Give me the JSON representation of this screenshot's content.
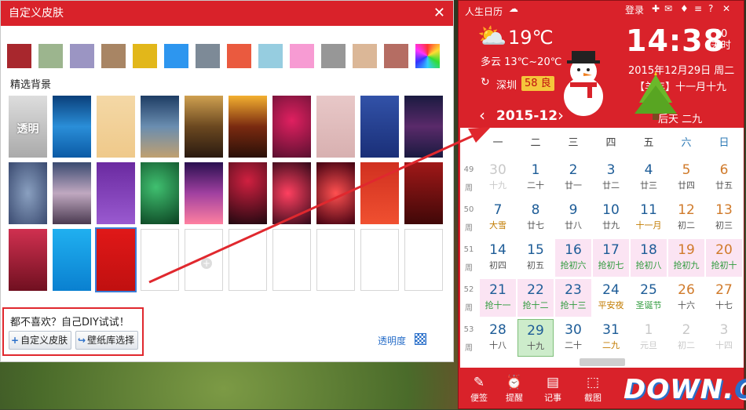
{
  "dialog": {
    "title": "自定义皮肤",
    "close": "✕",
    "swatches": [
      "#a8272d",
      "#9cb58e",
      "#9b95c3",
      "#a88564",
      "#e2b71a",
      "#2d96ef",
      "#7d8a97",
      "#ea5a3f",
      "#96cde0",
      "#f79bd3",
      "#979797",
      "#dbb797",
      "#b56d63",
      "rainbow"
    ],
    "section_title": "精选背景",
    "transparent_label": "透明",
    "diy_text": "都不喜欢？自己DIY试试！",
    "custom_btn": "自定义皮肤",
    "wallpaper_btn": "壁纸库选择",
    "opacity_label": "透明度"
  },
  "calendar": {
    "app_name": "人生日历",
    "login": "登录",
    "temperature": "19℃",
    "weather": "多云 13℃~20℃",
    "city": "深圳",
    "aqi": "58 良",
    "time": "14:38",
    "seconds": "10",
    "seconds_label": "未时",
    "date": "2015年12月29日 周二",
    "lunar": "【羊年】十一月十九",
    "month": "2015-12",
    "holiday_hint": "后天 二九",
    "weekdays": [
      "一",
      "二",
      "三",
      "四",
      "五",
      "六",
      "日"
    ],
    "week_numbers": [
      [
        "49",
        "周"
      ],
      [
        "50",
        "周"
      ],
      [
        "51",
        "周"
      ],
      [
        "52",
        "周"
      ],
      [
        "53",
        "周"
      ]
    ],
    "days": [
      [
        [
          "30",
          "十九",
          "out"
        ],
        [
          "1",
          "二十",
          ""
        ],
        [
          "2",
          "廿一",
          ""
        ],
        [
          "3",
          "廿二",
          ""
        ],
        [
          "4",
          "廿三",
          ""
        ],
        [
          "5",
          "廿四",
          "we"
        ],
        [
          "6",
          "廿五",
          "we"
        ]
      ],
      [
        [
          "7",
          "大雪",
          "jie"
        ],
        [
          "8",
          "廿七",
          ""
        ],
        [
          "9",
          "廿八",
          ""
        ],
        [
          "10",
          "廿九",
          ""
        ],
        [
          "11",
          "十一月",
          "jie"
        ],
        [
          "12",
          "初二",
          "we"
        ],
        [
          "13",
          "初三",
          "we"
        ]
      ],
      [
        [
          "14",
          "初四",
          ""
        ],
        [
          "15",
          "初五",
          ""
        ],
        [
          "16",
          "抢初六",
          "pink fest"
        ],
        [
          "17",
          "抢初七",
          "pink fest"
        ],
        [
          "18",
          "抢初八",
          "pink fest"
        ],
        [
          "19",
          "抢初九",
          "pink fest we"
        ],
        [
          "20",
          "抢初十",
          "pink fest we"
        ]
      ],
      [
        [
          "21",
          "抢十一",
          "pink fest"
        ],
        [
          "22",
          "抢十二",
          "pink fest"
        ],
        [
          "23",
          "抢十三",
          "pink fest"
        ],
        [
          "24",
          "平安夜",
          "jie"
        ],
        [
          "25",
          "圣诞节",
          "fest"
        ],
        [
          "26",
          "十六",
          "we"
        ],
        [
          "27",
          "十七",
          "we"
        ]
      ],
      [
        [
          "28",
          "十八",
          ""
        ],
        [
          "29",
          "十九",
          "today"
        ],
        [
          "30",
          "二十",
          ""
        ],
        [
          "31",
          "二九",
          "jie"
        ],
        [
          "1",
          "元旦",
          "out"
        ],
        [
          "2",
          "初二",
          "out"
        ],
        [
          "3",
          "十四",
          "out"
        ]
      ]
    ],
    "bottom": [
      "便签",
      "提醒",
      "记事",
      "截图"
    ],
    "logo_main": "DOWN.",
    "logo_cc": "CC"
  }
}
